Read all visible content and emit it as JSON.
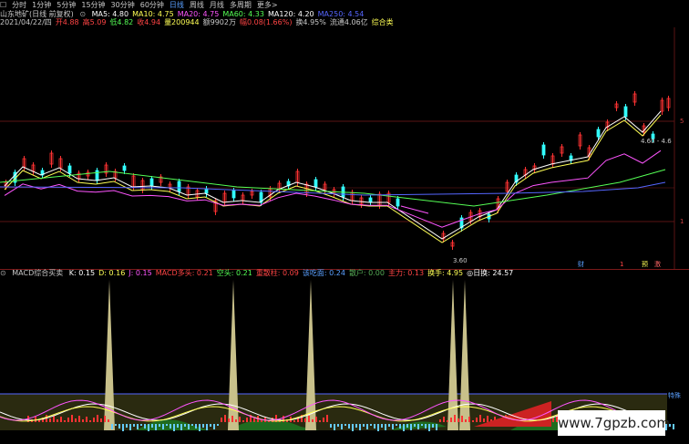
{
  "toolbar": {
    "tabs": [
      {
        "label": "☐"
      },
      {
        "label": "分时"
      },
      {
        "label": "1分钟"
      },
      {
        "label": "5分钟"
      },
      {
        "label": "15分钟"
      },
      {
        "label": "30分钟"
      },
      {
        "label": "60分钟"
      },
      {
        "label": "日线"
      },
      {
        "label": "周线"
      },
      {
        "label": "月线"
      },
      {
        "label": "多周期"
      },
      {
        "label": "更多>"
      }
    ],
    "active_index": 7
  },
  "ma_line": {
    "title": "山东地矿(日线 前复权)",
    "items": [
      {
        "label": "MA5: 4.80",
        "color": "#ffffff"
      },
      {
        "label": "MA10: 4.75",
        "color": "#ffff55"
      },
      {
        "label": "MA20: 4.75",
        "color": "#ff55ff"
      },
      {
        "label": "MA60: 4.33",
        "color": "#55ff55"
      },
      {
        "label": "MA120: 4.20",
        "color": "#ffffff"
      },
      {
        "label": "MA250: 4.54",
        "color": "#5566ff"
      }
    ]
  },
  "day_info": {
    "items": [
      {
        "label": "2021/04/22/四",
        "color": "#c8c8c8"
      },
      {
        "label": "开4.88",
        "color": "#ff4444"
      },
      {
        "label": "高5.09",
        "color": "#ff4444"
      },
      {
        "label": "低4.82",
        "color": "#55ff55"
      },
      {
        "label": "收4.94",
        "color": "#ff4444"
      },
      {
        "label": "量200944",
        "color": "#ffff55"
      },
      {
        "label": "额9902万",
        "color": "#c8c8c8"
      },
      {
        "label": "幅0.08(1.66%)",
        "color": "#ff4444"
      },
      {
        "label": "换4.95%",
        "color": "#c8c8c8"
      },
      {
        "label": "流通4.06亿",
        "color": "#c8c8c8"
      },
      {
        "label": "综合类",
        "color": "#ffff55"
      }
    ]
  },
  "price_labels": {
    "high": "4.60 - 4.6",
    "low": "3.60"
  },
  "right_axis": {
    "a": "5",
    "b": "1"
  },
  "bottom_markers": [
    {
      "label": "财",
      "color": "#5aa0ff"
    },
    {
      "label": "1",
      "color": "#ff4444"
    },
    {
      "label": "预",
      "color": "#ffff55"
    },
    {
      "label": "激",
      "color": "#ff6666"
    }
  ],
  "indicator": {
    "name": "MACD综合买卖",
    "items": [
      {
        "label": "K: 0.15",
        "color": "#ffffff"
      },
      {
        "label": "D: 0.16",
        "color": "#ffff55"
      },
      {
        "label": "J: 0.15",
        "color": "#ff55ff"
      },
      {
        "label": "MACD多头: 0.21",
        "color": "#ff4444"
      },
      {
        "label": "空头: 0.21",
        "color": "#55ff55"
      },
      {
        "label": "重散柱: 0.09",
        "color": "#ff4444"
      },
      {
        "label": "该吃面: 0.24",
        "color": "#5aa0ff"
      },
      {
        "label": "散户: 0.00",
        "color": "#55aa55"
      },
      {
        "label": "主力: 0.13",
        "color": "#ff4444"
      },
      {
        "label": "换手: 4.95",
        "color": "#ffff55"
      },
      {
        "label": "◎日换: 24.57",
        "color": "#ffffff"
      }
    ],
    "side_label": "特殊"
  },
  "watermark": {
    "text": "www.7gpzb.com"
  },
  "colors": {
    "up": "#ff3333",
    "down": "#33ffff",
    "spike": "#c8c08a",
    "separator": "#7a1a1a"
  }
}
